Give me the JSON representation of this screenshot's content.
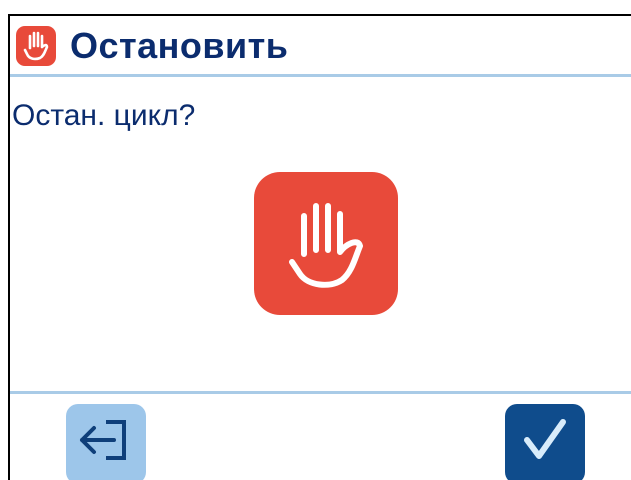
{
  "header": {
    "title": "Остановить",
    "icon": "stop-hand-icon"
  },
  "dialog": {
    "prompt": "Остан. цикл?",
    "icon": "stop-hand-icon"
  },
  "footer": {
    "back_icon": "exit-arrow-icon",
    "confirm_icon": "checkmark-icon"
  },
  "colors": {
    "accent_red": "#e84a3a",
    "title_text": "#0b2c6e",
    "divider": "#a9cbe7",
    "back_button_bg": "#9dc6ea",
    "confirm_button_bg": "#0f4c8c"
  }
}
